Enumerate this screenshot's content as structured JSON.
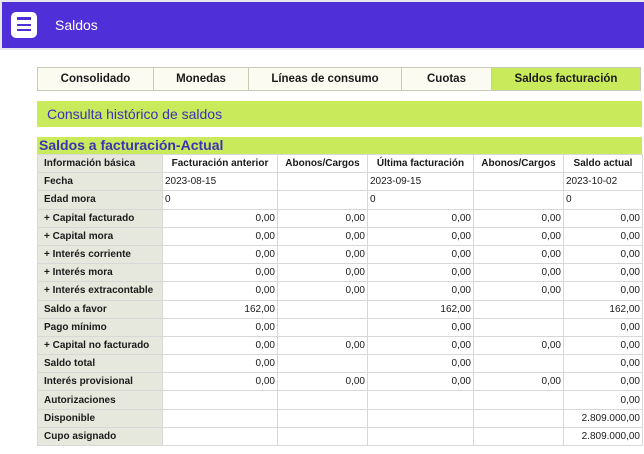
{
  "header": {
    "title": "Saldos"
  },
  "tabs": [
    "Consolidado",
    "Monedas",
    "Líneas de consumo",
    "Cuotas",
    "Saldos facturación"
  ],
  "active_tab": "Saldos facturación",
  "section_title": "Consulta histórico de saldos",
  "table": {
    "title": "Saldos a facturación-Actual",
    "columns": [
      "Información básica",
      "Facturación anterior",
      "Abonos/Cargos",
      "Última facturación",
      "Abonos/Cargos",
      "Saldo actual"
    ],
    "rows": [
      {
        "label": "Fecha",
        "cells": [
          "2023-08-15",
          "",
          "2023-09-15",
          "",
          "2023-10-02"
        ]
      },
      {
        "label": "Edad mora",
        "cells": [
          "0",
          "",
          "0",
          "",
          "0"
        ]
      },
      {
        "label": "+ Capital facturado",
        "cells": [
          "0,00",
          "0,00",
          "0,00",
          "0,00",
          "0,00"
        ]
      },
      {
        "label": "+ Capital mora",
        "cells": [
          "0,00",
          "0,00",
          "0,00",
          "0,00",
          "0,00"
        ]
      },
      {
        "label": "+ Interés corriente",
        "cells": [
          "0,00",
          "0,00",
          "0,00",
          "0,00",
          "0,00"
        ]
      },
      {
        "label": "+ Interés mora",
        "cells": [
          "0,00",
          "0,00",
          "0,00",
          "0,00",
          "0,00"
        ]
      },
      {
        "label": "+ Interés extracontable",
        "cells": [
          "0,00",
          "0,00",
          "0,00",
          "0,00",
          "0,00"
        ]
      },
      {
        "label": "Saldo a favor",
        "cells": [
          "162,00",
          "",
          "162,00",
          "",
          "162,00"
        ]
      },
      {
        "label": "Pago mínimo",
        "cells": [
          "0,00",
          "",
          "0,00",
          "",
          "0,00"
        ]
      },
      {
        "label": "+ Capital no facturado",
        "cells": [
          "0,00",
          "0,00",
          "0,00",
          "0,00",
          "0,00"
        ]
      },
      {
        "label": "Saldo total",
        "cells": [
          "0,00",
          "",
          "0,00",
          "",
          "0,00"
        ]
      },
      {
        "label": "Interés provisional",
        "cells": [
          "0,00",
          "0,00",
          "0,00",
          "0,00",
          "0,00"
        ]
      },
      {
        "label": "Autorizaciones",
        "cells": [
          "",
          "",
          "",
          "",
          "0,00"
        ]
      },
      {
        "label": "Disponible",
        "cells": [
          "",
          "",
          "",
          "",
          "2.809.000,00"
        ]
      },
      {
        "label": "Cupo asignado",
        "cells": [
          "",
          "",
          "",
          "",
          "2.809.000,00"
        ]
      }
    ]
  },
  "colors": {
    "header": "#4f2fd8",
    "accent": "#c9ea5a",
    "title_text": "#3a32b8"
  }
}
